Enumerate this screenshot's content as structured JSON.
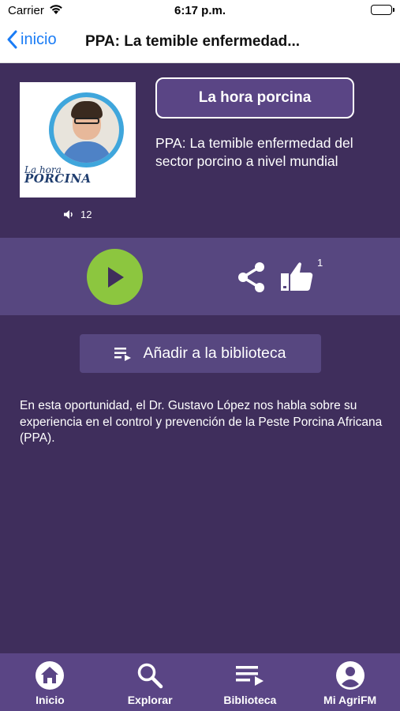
{
  "status_bar": {
    "carrier": "Carrier",
    "time": "6:17 p.m."
  },
  "nav": {
    "back_label": "inicio",
    "title": "PPA: La temible enfermedad..."
  },
  "episode": {
    "program_label": "La hora porcina",
    "title": "PPA: La temible enfermedad del sector porcino a nivel mundial",
    "listens": "12",
    "likes": "1",
    "cover_brand_line1": "La hora",
    "cover_brand_line2": "PORCINA"
  },
  "actions": {
    "add_to_library_label": "Añadir a la biblioteca"
  },
  "description": "En esta oportunidad, el Dr. Gustavo López nos habla sobre su experiencia en el control y prevención de la Peste Porcina Africana (PPA).",
  "tabs": [
    {
      "label": "Inicio",
      "icon": "home-icon"
    },
    {
      "label": "Explorar",
      "icon": "search-icon"
    },
    {
      "label": "Biblioteca",
      "icon": "library-icon"
    },
    {
      "label": "Mi AgriFM",
      "icon": "account-icon"
    }
  ],
  "colors": {
    "background": "#3f2e5c",
    "panel": "#574780",
    "tab_bar": "#5a4585",
    "play": "#8cc63f",
    "link": "#1a7cf5"
  }
}
